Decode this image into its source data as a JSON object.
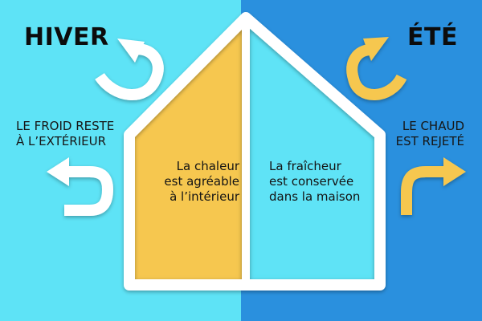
{
  "colors": {
    "winter_bg": "#5ee3f6",
    "summer_bg": "#2a90de",
    "winter_room": "#f6c74f",
    "summer_room": "#5ee3f6",
    "house_outline": "#ffffff",
    "winter_arrows": "#ffffff",
    "summer_arrows": "#f6c74f"
  },
  "winter": {
    "title": "HIVER",
    "side_caption": "LE FROID RESTE\nÀ L’EXTÉRIEUR",
    "room_caption": "La chaleur\nest agréable\nà l’intérieur",
    "arrow_icons": [
      "u-turn-up-arrow-icon",
      "u-turn-left-arrow-icon"
    ]
  },
  "summer": {
    "title": "ÉTÉ",
    "side_caption": "LE CHAUD\nEST REJETÉ",
    "room_caption": "La fraîcheur\nest conservée\ndans la maison",
    "arrow_icons": [
      "u-turn-up-arrow-icon",
      "u-turn-right-arrow-icon"
    ]
  }
}
